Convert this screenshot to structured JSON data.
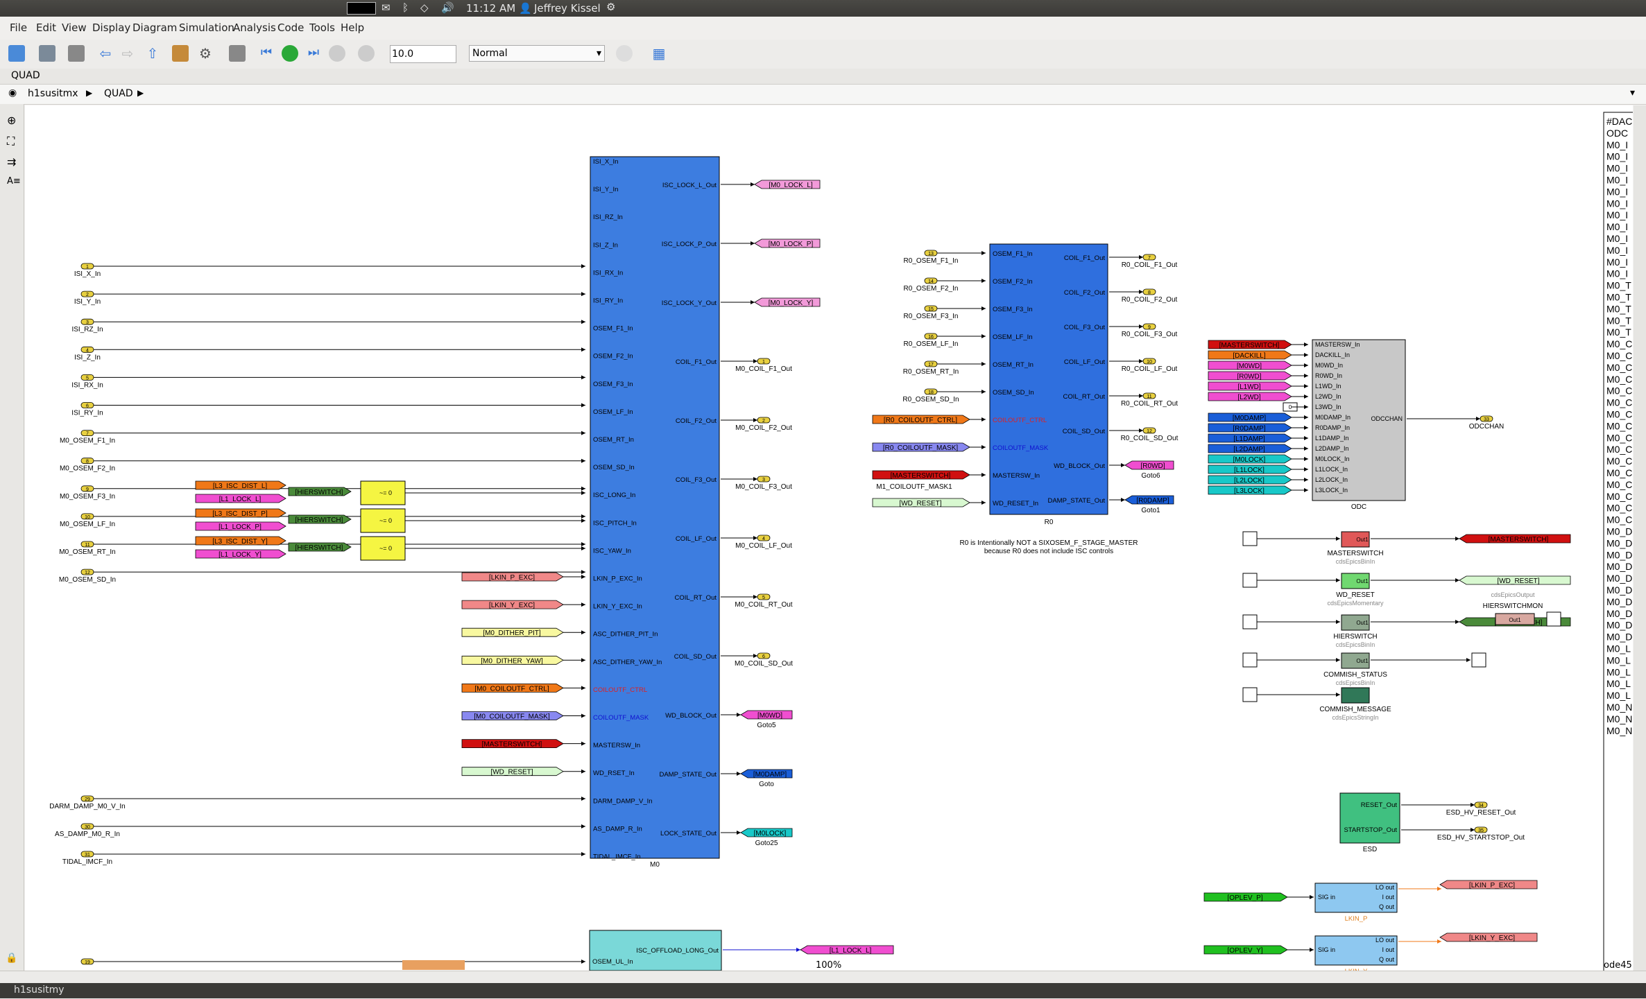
{
  "topbar": {
    "time": "11:12 AM",
    "user": "Jeffrey Kissel"
  },
  "menu": [
    "File",
    "Edit",
    "View",
    "Display",
    "Diagram",
    "Simulation",
    "Analysis",
    "Code",
    "Tools",
    "Help"
  ],
  "toolbar": {
    "stop_time": "10.0",
    "sim_mode": "Normal"
  },
  "tab": {
    "label": "QUAD"
  },
  "breadcrumb": [
    "h1susitmx",
    "QUAD"
  ],
  "status": {
    "zoom": "100%",
    "solver": "ode45"
  },
  "taskbar": {
    "window": "h1susitmy"
  },
  "colors": {
    "canvas": "#ffffff",
    "m0_block": "#3d7de0",
    "r0_block": "#2f6fde",
    "odc_block": "#c8c8c8",
    "pink": "#f29ad9",
    "magenta": "#f04ed0",
    "orange": "#f07818",
    "green": "#4a8a3a",
    "yellow": "#f5f542",
    "red": "#d01010",
    "blue": "#1a5ed8",
    "cyan": "#18c8c8",
    "salmon": "#f08888",
    "light_yellow": "#f8f8a0",
    "light_green": "#d8f8d0",
    "lavender": "#8888f0",
    "teal": "#7ad8d8",
    "esd": "#40c080"
  },
  "inports": [
    {
      "num": "1",
      "label": "ISI_X_In"
    },
    {
      "num": "2",
      "label": "ISI_Y_In"
    },
    {
      "num": "3",
      "label": "ISI_RZ_In"
    },
    {
      "num": "4",
      "label": "ISI_Z_In"
    },
    {
      "num": "5",
      "label": "ISI_RX_In"
    },
    {
      "num": "6",
      "label": "ISI_RY_In"
    },
    {
      "num": "7",
      "label": "M0_OSEM_F1_In"
    },
    {
      "num": "8",
      "label": "M0_OSEM_F2_In"
    },
    {
      "num": "9",
      "label": "M0_OSEM_F3_In"
    },
    {
      "num": "10",
      "label": "M0_OSEM_LF_In"
    },
    {
      "num": "11",
      "label": "M0_OSEM_RT_In"
    },
    {
      "num": "12",
      "label": "M0_OSEM_SD_In"
    }
  ],
  "inports_bottom": [
    {
      "num": "29",
      "label": "DARM_DAMP_M0_V_In"
    },
    {
      "num": "30",
      "label": "AS_DAMP_M0_R_In"
    },
    {
      "num": "31",
      "label": "TIDAL_IMCF_In"
    }
  ],
  "m0": {
    "name": "M0",
    "inputs": [
      "ISI_X_In",
      "ISI_Y_In",
      "ISI_RZ_In",
      "ISI_Z_In",
      "ISI_RX_In",
      "ISI_RY_In",
      "OSEM_F1_In",
      "OSEM_F2_In",
      "OSEM_F3_In",
      "OSEM_LF_In",
      "OSEM_RT_In",
      "OSEM_SD_In",
      "ISC_LONG_In",
      "ISC_PITCH_In",
      "ISC_YAW_In",
      "LKIN_P_EXC_In",
      "LKIN_Y_EXC_In",
      "ASC_DITHER_PIT_In",
      "ASC_DITHER_YAW_In",
      "COILOUTF_CTRL",
      "COILOUTF_MASK",
      "MASTERSW_In",
      "WD_RSET_In",
      "DARM_DAMP_V_In",
      "AS_DAMP_R_In",
      "TIDAL_IMCF_In"
    ],
    "outputs": [
      "ISC_LOCK_L_Out",
      "ISC_LOCK_P_Out",
      "ISC_LOCK_Y_Out",
      "COIL_F1_Out",
      "COIL_F2_Out",
      "COIL_F3_Out",
      "COIL_LF_Out",
      "COIL_RT_Out",
      "COIL_SD_Out",
      "WD_BLOCK_Out",
      "DAMP_STATE_Out",
      "LOCK_STATE_Out"
    ]
  },
  "m0_out_tags": [
    {
      "tag": "[M0_LOCK_L]"
    },
    {
      "tag": "[M0_LOCK_P]"
    },
    {
      "tag": "[M0_LOCK_Y]"
    }
  ],
  "m0_outports": [
    {
      "num": "1",
      "label": "M0_COIL_F1_Out"
    },
    {
      "num": "2",
      "label": "M0_COIL_F2_Out"
    },
    {
      "num": "3",
      "label": "M0_COIL_F3_Out"
    },
    {
      "num": "4",
      "label": "M0_COIL_LF_Out"
    },
    {
      "num": "5",
      "label": "M0_COIL_RT_Out"
    },
    {
      "num": "6",
      "label": "M0_COIL_SD_Out"
    }
  ],
  "m0_gotos": [
    {
      "tag": "[M0WD]",
      "label": "Goto5"
    },
    {
      "tag": "[M0DAMP]",
      "label": "Goto"
    },
    {
      "tag": "[M0LOCK]",
      "label": "Goto25"
    }
  ],
  "isc_froms": [
    {
      "a": "[L3_ISC_DIST_L]",
      "b": "[L1_LOCK_L]"
    },
    {
      "a": "[L3_ISC_DIST_P]",
      "b": "[L1_LOCK_P]"
    },
    {
      "a": "[L3_ISC_DIST_Y]",
      "b": "[L1_LOCK_Y]"
    }
  ],
  "hierswitch_tag": "[HIERSWITCH]",
  "switch_label": "~= 0",
  "m0_froms": [
    "[LKIN_P_EXC]",
    "[LKIN_Y_EXC]",
    "[M0_DITHER_PIT]",
    "[M0_DITHER_YAW]",
    "[M0_COILOUTF_CTRL]",
    "[M0_COILOUTF_MASK]",
    "[MASTERSWITCH]",
    "[WD_RESET]"
  ],
  "r0": {
    "name": "R0",
    "inputs": [
      "OSEM_F1_In",
      "OSEM_F2_In",
      "OSEM_F3_In",
      "OSEM_LF_In",
      "OSEM_RT_In",
      "OSEM_SD_In",
      "COILOUTF_CTRL",
      "COILOUTF_MASK",
      "MASTERSW_In",
      "WD_RESET_In"
    ],
    "outputs": [
      "COIL_F1_Out",
      "COIL_F2_Out",
      "COIL_F3_Out",
      "COIL_LF_Out",
      "COIL_RT_Out",
      "COIL_SD_Out",
      "WD_BLOCK_Out",
      "DAMP_STATE_Out"
    ]
  },
  "r0_inports": [
    {
      "num": "13",
      "label": "R0_OSEM_F1_In"
    },
    {
      "num": "14",
      "label": "R0_OSEM_F2_In"
    },
    {
      "num": "15",
      "label": "R0_OSEM_F3_In"
    },
    {
      "num": "16",
      "label": "R0_OSEM_LF_In"
    },
    {
      "num": "17",
      "label": "R0_OSEM_RT_In"
    },
    {
      "num": "18",
      "label": "R0_OSEM_SD_In"
    }
  ],
  "r0_froms": [
    {
      "tag": "[R0_COILOUTF_CTRL]",
      "label": ""
    },
    {
      "tag": "[R0_COILOUTF_MASK]",
      "label": ""
    },
    {
      "tag": "[MASTERSWITCH]",
      "label": "M1_COILOUTF_MASK1"
    },
    {
      "tag": "[WD_RESET]",
      "label": ""
    }
  ],
  "r0_outports": [
    {
      "num": "7",
      "label": "R0_COIL_F1_Out"
    },
    {
      "num": "8",
      "label": "R0_COIL_F2_Out"
    },
    {
      "num": "9",
      "label": "R0_COIL_F3_Out"
    },
    {
      "num": "10",
      "label": "R0_COIL_LF_Out"
    },
    {
      "num": "11",
      "label": "R0_COIL_RT_Out"
    },
    {
      "num": "12",
      "label": "R0_COIL_SD_Out"
    }
  ],
  "r0_gotos": [
    {
      "tag": "[R0WD]",
      "label": "Goto6"
    },
    {
      "tag": "[R0DAMP]",
      "label": "Goto1"
    }
  ],
  "r0_note": [
    "R0 is Intentionally NOT a SIXOSEM_F_STAGE_MASTER",
    "because R0 does not include ISC controls"
  ],
  "odc": {
    "name": "ODC",
    "inputs": [
      "MASTERSW_In",
      "DACKILL_In",
      "M0WD_In",
      "R0WD_In",
      "L1WD_In",
      "L2WD_In",
      "L3WD_In",
      "M0DAMP_In",
      "R0DAMP_In",
      "L1DAMP_In",
      "L2DAMP_In",
      "M0LOCK_In",
      "L1LOCK_In",
      "L2LOCK_In",
      "L3LOCK_In"
    ],
    "output": "ODCCHAN",
    "outport_num": "33",
    "outport_label": "ODCCHAN"
  },
  "odc_froms": [
    "[MASTERSWITCH]",
    "[DACKILL]",
    "[M0WD]",
    "[R0WD]",
    "[L1WD]",
    "[L2WD]",
    "",
    "[M0DAMP]",
    "[R0DAMP]",
    "[L1DAMP]",
    "[L2DAMP]",
    "[M0LOCK]",
    "[L1LOCK]",
    "[L2LOCK]",
    "[L3LOCK]"
  ],
  "odc_const": "0",
  "epics": [
    {
      "name": "MASTERSWITCH",
      "type": "cdsEpicsBinIn",
      "tag": "[MASTERSWITCH]"
    },
    {
      "name": "WD_RESET",
      "type": "cdsEpicsMomentary",
      "tag": "[WD_RESET]",
      "sub": "cdsEpicsOutput"
    },
    {
      "name": "HIERSWITCH",
      "type": "cdsEpicsBinIn",
      "tag": "[HIERSWITCH]"
    },
    {
      "name": "COMMISH_STATUS",
      "type": "cdsEpicsBinIn"
    },
    {
      "name": "COMMISH_MESSAGE",
      "type": "cdsEpicsStringIn"
    }
  ],
  "hierswitchmon": "HIERSWITCHMON",
  "out1": "Out1",
  "esd": {
    "name": "ESD",
    "ports": [
      "RESET_Out",
      "STARTSTOP_Out"
    ],
    "outports": [
      {
        "num": "34",
        "label": "ESD_HV_RESET_Out"
      },
      {
        "num": "35",
        "label": "ESD_HV_STARTSTOP_Out"
      }
    ]
  },
  "lkin": [
    {
      "from": "[OPLEV_P]",
      "name": "LKIN_P",
      "tag": "[LKIN_P_EXC]"
    },
    {
      "from": "[OPLEV_Y]",
      "name": "LKIN_Y",
      "tag": "[LKIN_Y_EXC]"
    }
  ],
  "lkin_ports": {
    "in": "SIG in",
    "outs": [
      "LO out",
      "I out",
      "Q out"
    ]
  },
  "bottom": {
    "port": "ISC_OFFLOAD_LONG_Out",
    "in": "OSEM_UL_In",
    "tag": "[L1_LOCK_L]",
    "inport_num": "19"
  },
  "right_panel": [
    "#DAC",
    "ODC",
    "M0_I",
    "M0_I",
    "M0_I",
    "M0_I",
    "M0_I",
    "M0_I",
    "M0_I",
    "M0_I",
    "M0_I",
    "M0_I",
    "M0_I",
    "M0_I",
    "M0_T",
    "M0_T",
    "M0_T",
    "M0_T",
    "M0_T",
    "M0_C",
    "M0_C",
    "M0_C",
    "M0_C",
    "M0_C",
    "M0_C",
    "M0_C",
    "M0_C",
    "M0_C",
    "M0_C",
    "M0_C",
    "M0_C",
    "M0_C",
    "M0_C",
    "M0_C",
    "M0_C",
    "M0_D",
    "M0_D",
    "M0_D",
    "M0_D",
    "M0_D",
    "M0_D",
    "M0_D",
    "M0_D",
    "M0_D",
    "M0_D",
    "M0_L",
    "M0_L",
    "M0_L",
    "M0_L",
    "M0_L",
    "M0_N",
    "M0_N",
    "M0_N"
  ]
}
